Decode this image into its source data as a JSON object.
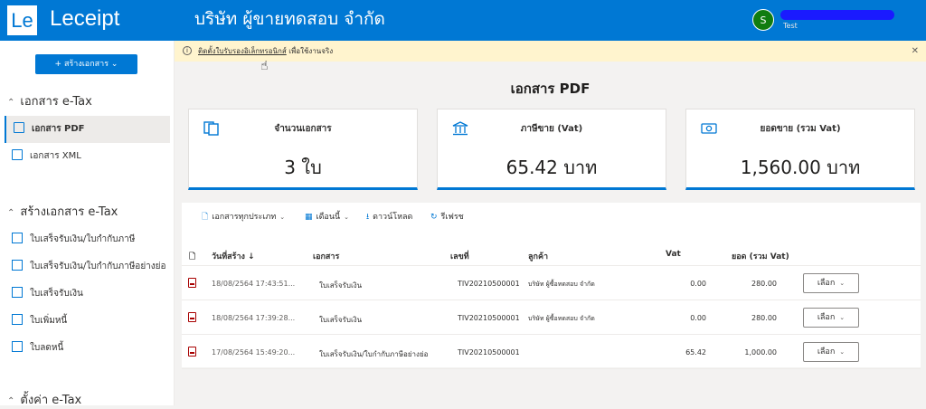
{
  "header": {
    "logo": "Le",
    "app_name": "Leceipt",
    "company": "บริษัท ผู้ขายทดสอบ จำกัด",
    "avatar_initial": "S",
    "username": "redacted",
    "user_role": "Test"
  },
  "sidebar": {
    "create_button": "+ สร้างเอกสาร ⌄",
    "groups": [
      {
        "title": "เอกสาร e-Tax",
        "items": [
          "เอกสาร PDF",
          "เอกสาร XML"
        ]
      },
      {
        "title": "สร้างเอกสาร e-Tax",
        "items": [
          "ใบเสร็จรับเงิน/ใบกำกับภาษี",
          "ใบเสร็จรับเงิน/ใบกำกับภาษีอย่างย่อ",
          "ใบเสร็จรับเงิน",
          "ใบเพิ่มหนี้",
          "ใบลดหนี้"
        ]
      },
      {
        "title": "ตั้งค่า e-Tax"
      }
    ]
  },
  "banner": {
    "link": "ติดตั้งใบรับรองอิเล็กทรอนิกส์",
    "text": " เพื่อใช้งานจริง",
    "close": "✕"
  },
  "page_title": "เอกสาร PDF",
  "cards": [
    {
      "icon": "documents-icon",
      "label": "จำนวนเอกสาร",
      "value": "3 ใบ"
    },
    {
      "icon": "bank-icon",
      "label": "ภาษีขาย (Vat)",
      "value": "65.42 บาท"
    },
    {
      "icon": "money-icon",
      "label": "ยอดขาย (รวม Vat)",
      "value": "1,560.00 บาท"
    }
  ],
  "toolbar": {
    "doc_type": "เอกสารทุกประเภท",
    "month": "เดือนนี้",
    "download": "ดาวน์โหลด",
    "refresh": "รีเฟรช"
  },
  "table": {
    "headers": {
      "date": "วันที่สร้าง ↓",
      "doc": "เอกสาร",
      "number": "เลขที่",
      "customer": "ลูกค้า",
      "vat": "Vat",
      "total": "ยอด (รวม Vat)"
    },
    "rows": [
      {
        "date": "18/08/2564 17:43:51...",
        "doc": "ใบเสร็จรับเงิน",
        "number": "TIV20210500001",
        "customer": "บริษัท ผู้ซื้อทดสอบ จำกัด",
        "vat": "0.00",
        "total": "280.00",
        "action": "เลือก"
      },
      {
        "date": "18/08/2564 17:39:28...",
        "doc": "ใบเสร็จรับเงิน",
        "number": "TIV20210500001",
        "customer": "บริษัท ผู้ซื้อทดสอบ จำกัด",
        "vat": "0.00",
        "total": "280.00",
        "action": "เลือก"
      },
      {
        "date": "17/08/2564 15:49:20...",
        "doc": "ใบเสร็จรับเงิน/ใบกำกับภาษีอย่างย่อ",
        "number": "TIV20210500001",
        "customer": "",
        "vat": "65.42",
        "total": "1,000.00",
        "action": "เลือก"
      }
    ]
  },
  "colors": {
    "primary": "#0078d4",
    "banner": "#fff4ce",
    "avatar": "#107c10"
  }
}
